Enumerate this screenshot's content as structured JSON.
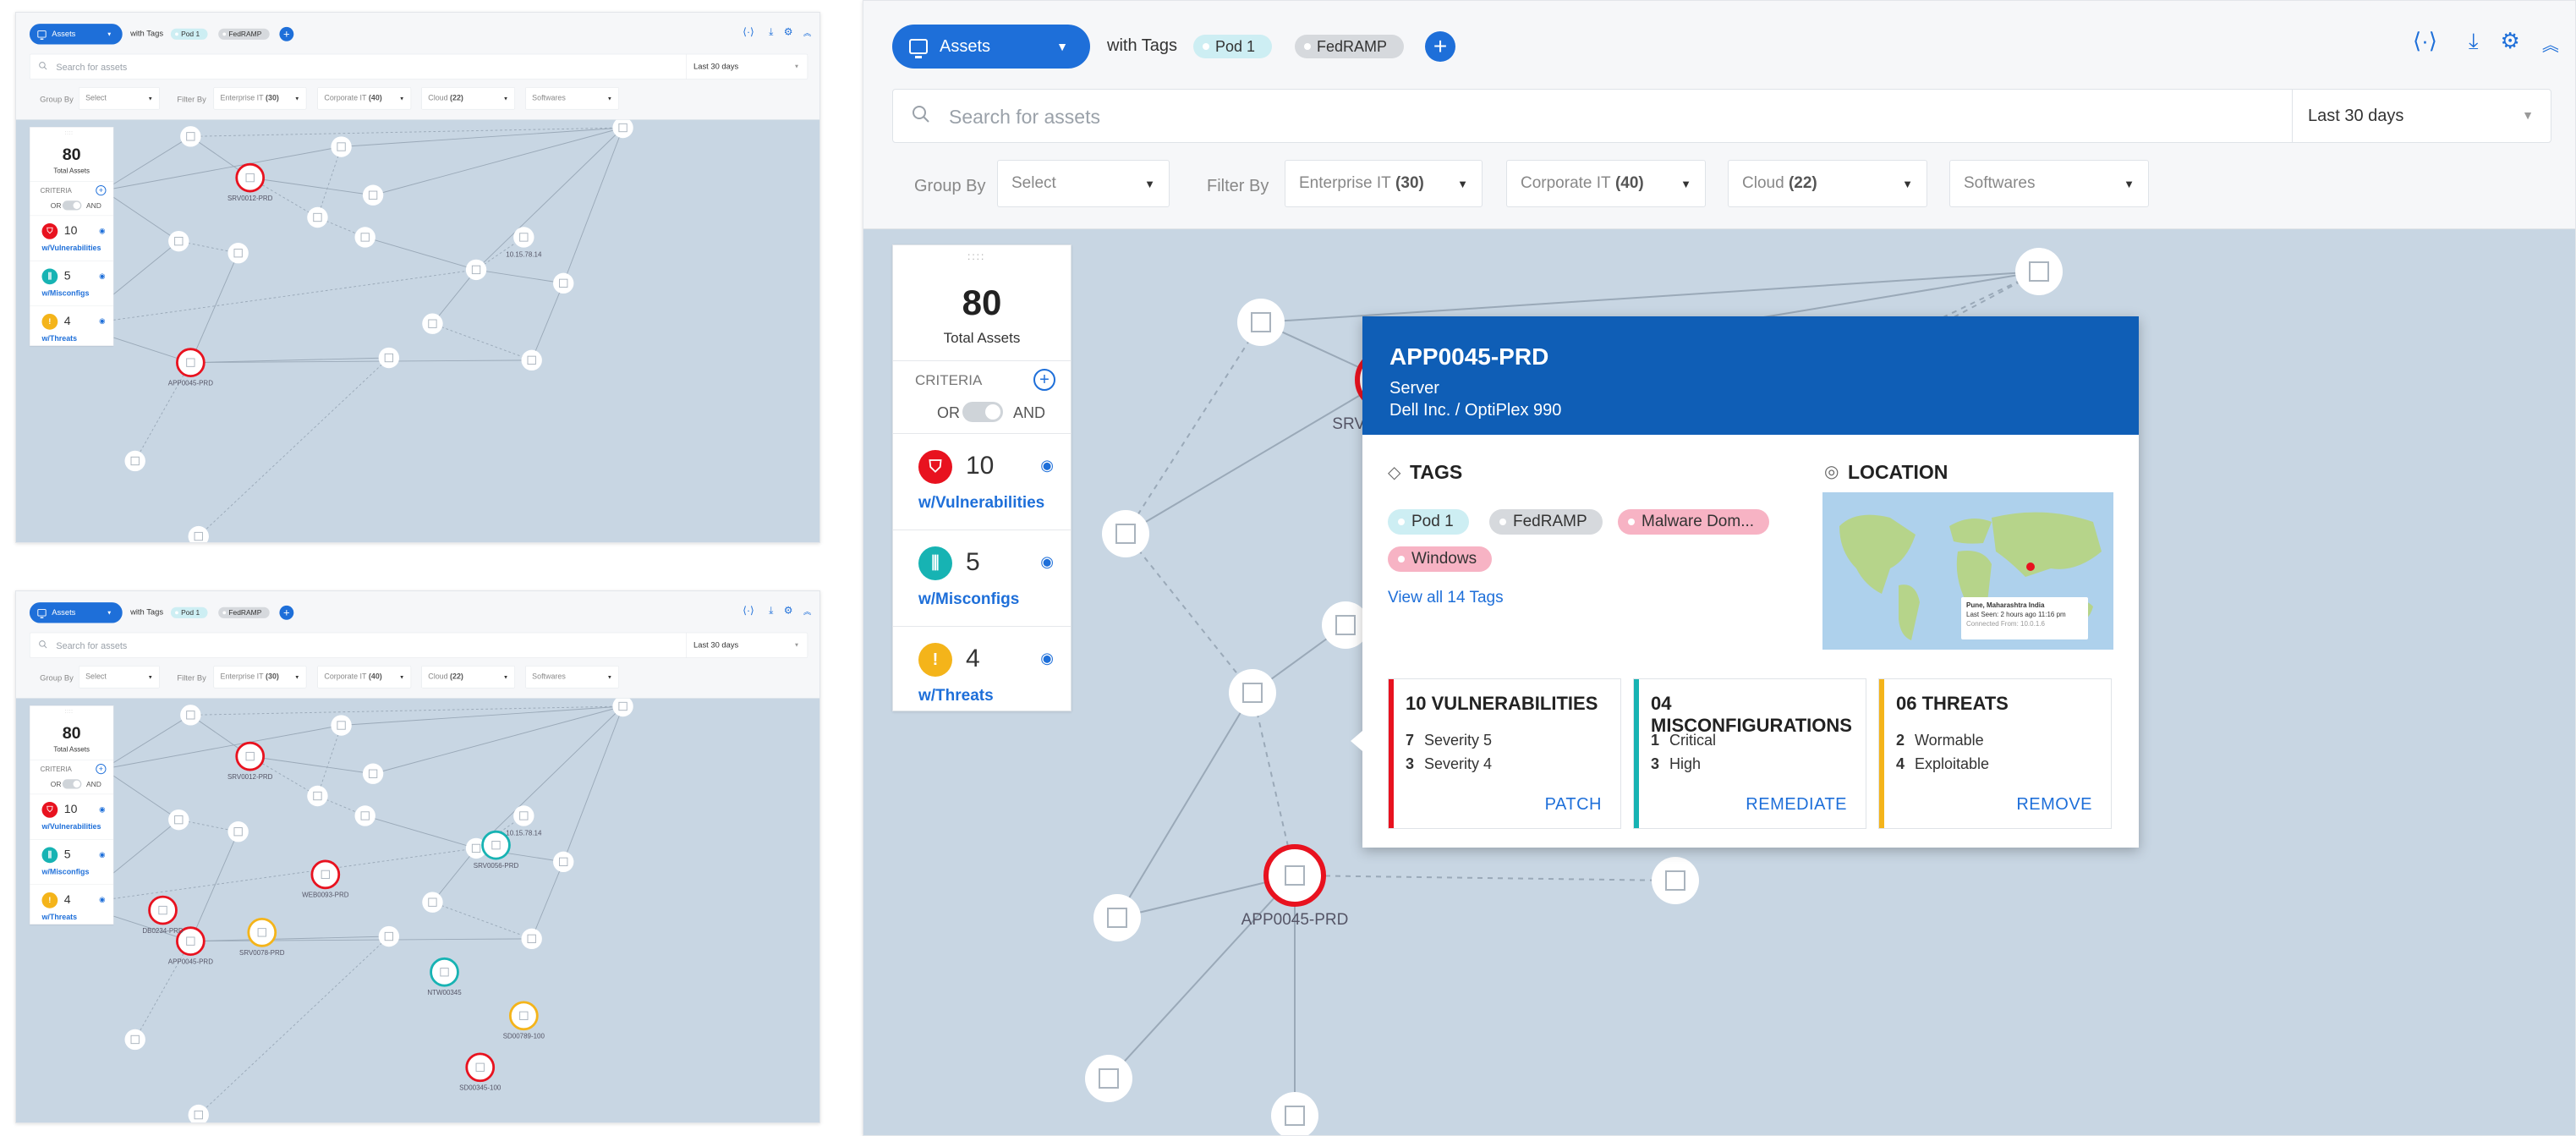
{
  "header": {
    "assets_label": "Assets",
    "with_tags": "with Tags",
    "tags": [
      {
        "label": "Pod 1",
        "color": "#cdeef3"
      },
      {
        "label": "FedRAMP",
        "color": "#d6d9dd"
      }
    ]
  },
  "search": {
    "placeholder": "Search for assets",
    "date_range": "Last 30 days"
  },
  "filters": {
    "group_by_label": "Group By",
    "group_by_value": "Select",
    "filter_by_label": "Filter By",
    "enterprise_label": "Enterprise IT",
    "enterprise_count": "(30)",
    "corporate_label": "Corporate IT",
    "corporate_count": "(40)",
    "cloud_label": "Cloud",
    "cloud_count": "(22)",
    "softwares_label": "Softwares"
  },
  "summary": {
    "total": "80",
    "total_label": "Total Assets",
    "criteria_label": "CRITERIA",
    "or_label": "OR",
    "and_label": "AND",
    "items": [
      {
        "count": "10",
        "label": "w/Vulnerabilities",
        "color": "#e8121f"
      },
      {
        "count": "5",
        "label": "w/Misconfigs",
        "color": "#17b3b3"
      },
      {
        "count": "4",
        "label": "w/Threats",
        "color": "#f4b41a"
      }
    ]
  },
  "graph": {
    "labels": {
      "srv0012": "SRV0012-PRD",
      "app0045": "APP0045-PRD",
      "ip": "10.15.78.14",
      "srv0056": "SRV0056-PRD",
      "web0093": "WEB0093-PRD",
      "db0234": "DB0234-PRD",
      "srv0078": "SRV0078-PRD",
      "ntw00345": "NTW00345",
      "sd00789": "SD00789-100",
      "sd00345": "SD00345-100"
    }
  },
  "popup": {
    "title": "APP0045-PRD",
    "type": "Server",
    "model": "Dell Inc. / OptiPlex 990",
    "tags_title": "TAGS",
    "location_title": "LOCATION",
    "tags": [
      {
        "label": "Pod 1",
        "color": "#cdeef3"
      },
      {
        "label": "FedRAMP",
        "color": "#d6d9dd"
      },
      {
        "label": "Malware Dom...",
        "color": "#f7b3c4"
      },
      {
        "label": "Windows",
        "color": "#f7b3c4"
      }
    ],
    "view_all": "View all 14 Tags",
    "map_tooltip": {
      "city": "Pune, Maharashtra India",
      "seen": "Last Seen: 2 hours ago 11:16 pm",
      "from": "Connected From: 10.0.1.6"
    },
    "cards": [
      {
        "title": "10 VULNERABILITIES",
        "rows": [
          {
            "n": "7",
            "t": "Severity 5"
          },
          {
            "n": "3",
            "t": "Severity 4"
          }
        ],
        "action": "PATCH",
        "color": "#e8121f"
      },
      {
        "title": "04 MISCONFIGURATIONS",
        "rows": [
          {
            "n": "1",
            "t": "Critical"
          },
          {
            "n": "3",
            "t": "High"
          }
        ],
        "action": "REMEDIATE",
        "color": "#17b3b3"
      },
      {
        "title": "06 THREATS",
        "rows": [
          {
            "n": "2",
            "t": "Wormable"
          },
          {
            "n": "4",
            "t": "Exploitable"
          }
        ],
        "action": "REMOVE",
        "color": "#f4b41a"
      }
    ]
  }
}
